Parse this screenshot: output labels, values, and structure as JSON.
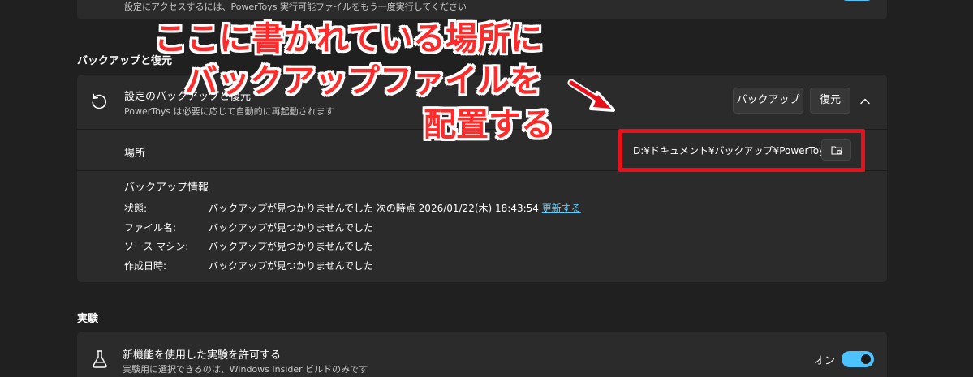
{
  "top": {
    "description": "設定にアクセスするには、PowerToys 実行可能ファイルをもう一度実行してください"
  },
  "backup_section": {
    "title": "バックアップと復元",
    "row": {
      "title": "設定のバックアップと復元",
      "subtitle": "PowerToys は必要に応じて自動的に再起動されます",
      "backup_button": "バックアップ",
      "restore_button": "復元"
    },
    "location": {
      "label": "場所",
      "path": "D:¥ドキュメント¥バックアップ¥PowerToys"
    },
    "info": {
      "title": "バックアップ情報",
      "rows": [
        {
          "key": "状態:",
          "value": "バックアップが見つかりませんでした 次の時点 2026/01/22(木) 18:43:54",
          "link": "更新する"
        },
        {
          "key": "ファイル名:",
          "value": "バックアップが見つかりませんでした"
        },
        {
          "key": "ソース マシン:",
          "value": "バックアップが見つかりませんでした"
        },
        {
          "key": "作成日時:",
          "value": "バックアップが見つかりませんでした"
        }
      ]
    }
  },
  "experiment_section": {
    "title": "実験",
    "row": {
      "title": "新機能を使用した実験を許可する",
      "subtitle": "実験用に選択できるのは、Windows Insider ビルドのみです",
      "toggle_label": "オン",
      "toggle_on": true
    }
  },
  "annotation": {
    "line1": "ここに書かれている場所に",
    "line2": "バックアップファイルを",
    "line3": "配置する",
    "color": "#ff2a2a",
    "box_color": "#e8101a"
  },
  "colors": {
    "background": "#202020",
    "card": "#2b2b2b",
    "accent": "#4cc2ff",
    "link": "#60cdff"
  }
}
